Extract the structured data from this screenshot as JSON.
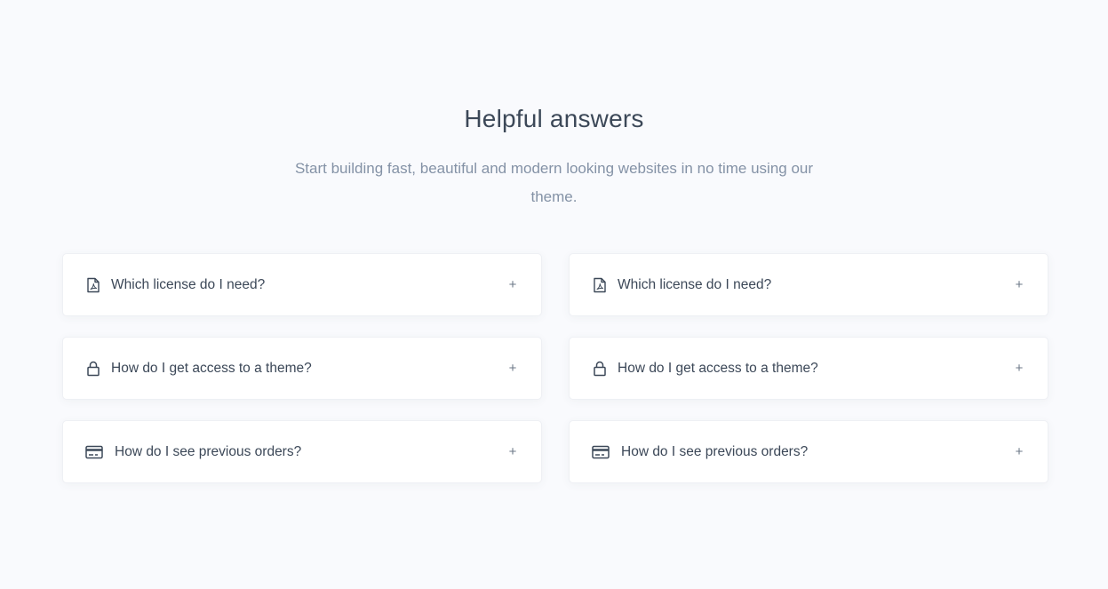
{
  "section": {
    "title": "Helpful answers",
    "subtitle": "Start building fast, beautiful and modern looking websites in no time using our theme."
  },
  "faq": {
    "left": [
      {
        "question": "Which license do I need?",
        "icon": "file-pdf-icon",
        "toggle": "+"
      },
      {
        "question": "How do I get access to a theme?",
        "icon": "lock-icon",
        "toggle": "+"
      },
      {
        "question": "How do I see previous orders?",
        "icon": "credit-card-icon",
        "toggle": "+"
      }
    ],
    "right": [
      {
        "question": "Which license do I need?",
        "icon": "file-pdf-icon",
        "toggle": "+"
      },
      {
        "question": "How do I get access to a theme?",
        "icon": "lock-icon",
        "toggle": "+"
      },
      {
        "question": "How do I see previous orders?",
        "icon": "credit-card-icon",
        "toggle": "+"
      }
    ]
  },
  "colors": {
    "background": "#f9fafd",
    "heading": "#3c4858",
    "muted": "#8492a6",
    "card": "#ffffff"
  }
}
